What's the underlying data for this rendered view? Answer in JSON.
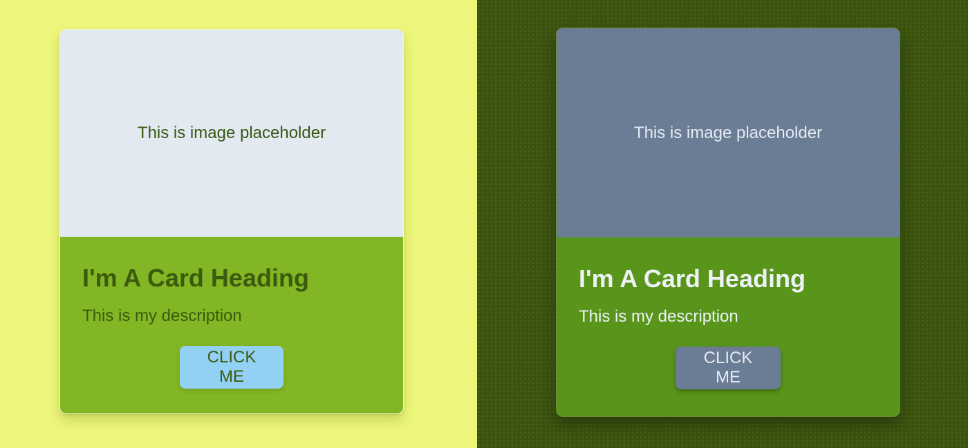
{
  "light_card": {
    "image_placeholder": "This is image placeholder",
    "heading": "I'm A Card Heading",
    "description": "This is my description",
    "button_label": "CLICK ME"
  },
  "dark_card": {
    "image_placeholder": "This is image placeholder",
    "heading": "I'm A Card Heading",
    "description": "This is my description",
    "button_label": "CLICK ME"
  },
  "colors": {
    "light_background": "#eef77c",
    "dark_background": "#3b5310",
    "light_card_body": "#83b624",
    "dark_card_body": "#58951a",
    "light_image": "#e2e9f1",
    "dark_image": "#6b7c95",
    "light_button": "#92d1f4",
    "dark_button": "#6b7c95"
  }
}
